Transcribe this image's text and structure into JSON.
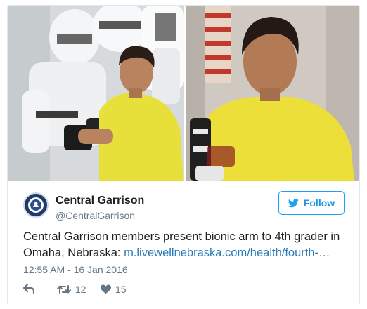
{
  "account": {
    "name": "Central Garrison",
    "handle": "@CentralGarrison",
    "avatar_icon": "garrison-emblem-icon"
  },
  "follow_button": {
    "label": "Follow",
    "icon": "twitter-bird-icon",
    "color": "#1da1f2"
  },
  "tweet": {
    "text": "Central Garrison members present bionic arm to 4th grader in Omaha, Nebraska: ",
    "link_text": "m.livewellnebraska.com/health/fourth-…",
    "timestamp": "12:55 AM - 16 Jan 2016"
  },
  "actions": {
    "reply": {
      "icon": "reply-icon"
    },
    "retweet": {
      "icon": "retweet-icon",
      "count": "12"
    },
    "like": {
      "icon": "heart-icon",
      "count": "15"
    }
  },
  "media": {
    "images": [
      {
        "icon": "photo-boy-with-stormtroopers"
      },
      {
        "icon": "photo-boy-with-bionic-arm"
      }
    ]
  },
  "colors": {
    "link": "#2b7bb9",
    "muted": "#657786",
    "border": "#e1e8ed"
  }
}
